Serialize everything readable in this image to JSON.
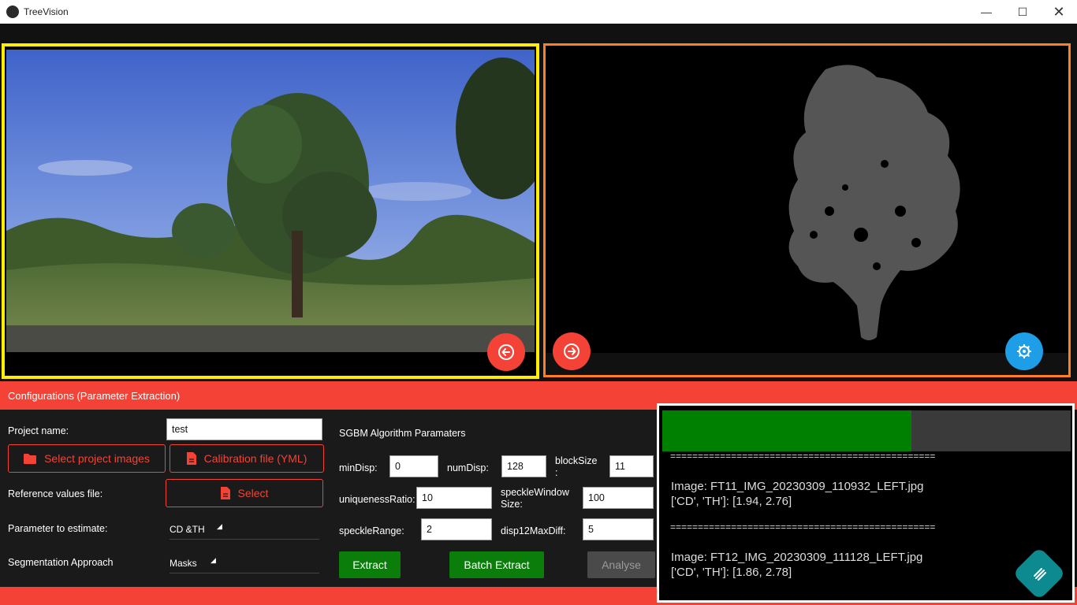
{
  "window": {
    "title": "TreeVision"
  },
  "config": {
    "header": "Configurations (Parameter Extraction)",
    "project_name_label": "Project name:",
    "project_name_value": "test",
    "select_images_label": "Select project images",
    "calibration_label": "Calibration file (YML)",
    "reference_label": "Reference values file:",
    "select_label": "Select",
    "param_label": "Parameter to estimate:",
    "param_value": "CD &TH",
    "segmentation_label": "Segmentation Approach",
    "segmentation_value": "Masks"
  },
  "sgbm": {
    "title": "SGBM Algorithm Paramaters",
    "minDisp_label": "minDisp:",
    "minDisp_value": "0",
    "numDisp_label": "numDisp:",
    "numDisp_value": "128",
    "blockSize_label": "blockSize\n:",
    "blockSize_value": "11",
    "uniqueness_label": "uniquenessRatio:",
    "uniqueness_value": "10",
    "speckleWindow_label": "speckleWindow\nSize:",
    "speckleWindow_value": "100",
    "speckleRange_label": "speckleRange:",
    "speckleRange_value": "2",
    "disp12_label": "disp12MaxDiff:",
    "disp12_value": "5"
  },
  "actions": {
    "extract": "Extract",
    "batch_extract": "Batch Extract",
    "analyse": "Analyse"
  },
  "log": {
    "progress": 0.61,
    "separator1": "================================================",
    "entry1_image": "Image: FT11_IMG_20230309_110932_LEFT.jpg",
    "entry1_values": "['CD', 'TH']: [1.94, 2.76]",
    "separator2": "================================================",
    "entry2_image": "Image: FT12_IMG_20230309_111128_LEFT.jpg",
    "entry2_values": "['CD', 'TH']: [1.86, 2.78]"
  },
  "icons": {
    "prev": "arrow-left-circle-icon",
    "next": "arrow-right-circle-icon",
    "settings": "gear-icon",
    "folder": "folder-icon",
    "file": "file-icon",
    "menu": "menu-icon"
  },
  "colors": {
    "accent": "#f44336",
    "left_border": "#ffee00",
    "right_border": "#ff7f27",
    "progress": "#008000",
    "fab_blue": "#1e9ee6",
    "fab_teal": "#0d8a8f"
  }
}
